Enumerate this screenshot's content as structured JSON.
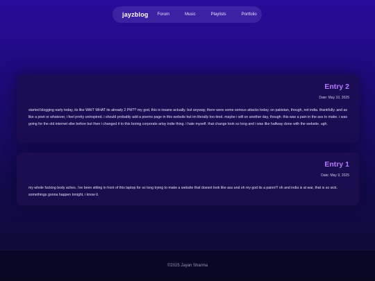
{
  "nav": {
    "brand": "jayzblog",
    "links": [
      "Forum",
      "Music",
      "Playlists",
      "Portfolio"
    ]
  },
  "entries": [
    {
      "title": "Entry 2",
      "date": "Date: May 10, 2025",
      "body": "started blogging early today, its like WAIT WHAT its already 2 PM?? my god, this is insane actually. but anyway, there were some serious attacks today. on pakistan, though, not india. thankfully. and as like a poet or whatever, i feel pretty uninspired. i should probably add a poems page in this website but im literally too tired. maybe i will on another day, though. this was a pain in the ass to make. i was going for the old internet vibe before but then i changed it to this boring corporate artsy indie thing. i hate myself. that change took so long and i was like halfway done with the website. ugh."
    },
    {
      "title": "Entry 1",
      "date": "Date: May 9, 2025",
      "body": "my whole fucking body aches. i've been sitting in front of this laptop for so long trying to make a website that doesnt look like ass and oh my god its a painn!!! oh and india is at war, that is so sick. somethings gonna happen tonight, i know it."
    }
  ],
  "footer": {
    "text": "©2025 Jayan Sharma"
  }
}
